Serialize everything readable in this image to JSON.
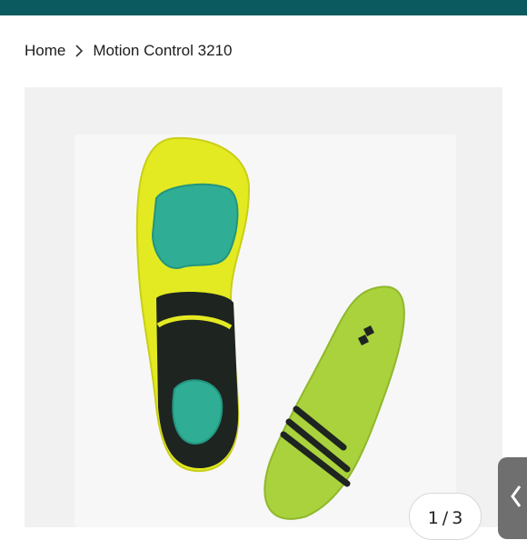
{
  "breadcrumb": {
    "home_label": "Home",
    "current_label": "Motion Control 3210"
  },
  "gallery": {
    "counter_current": "1",
    "counter_sep": "/",
    "counter_total": "3",
    "image_alt": "Motion Control 3210 insoles product photo"
  },
  "icons": {
    "breadcrumb_separator": "chevron-right-icon",
    "side_tab": "chevron-left-icon",
    "brand_logo": "nb-logo"
  },
  "colors": {
    "header_bar": "#0b5a5f",
    "gallery_bg": "#f1f1f1",
    "insole_yellow": "#e3ea22",
    "insole_teal": "#2fae95",
    "insole_lime": "#a9d23d",
    "insole_black": "#1e2420"
  }
}
